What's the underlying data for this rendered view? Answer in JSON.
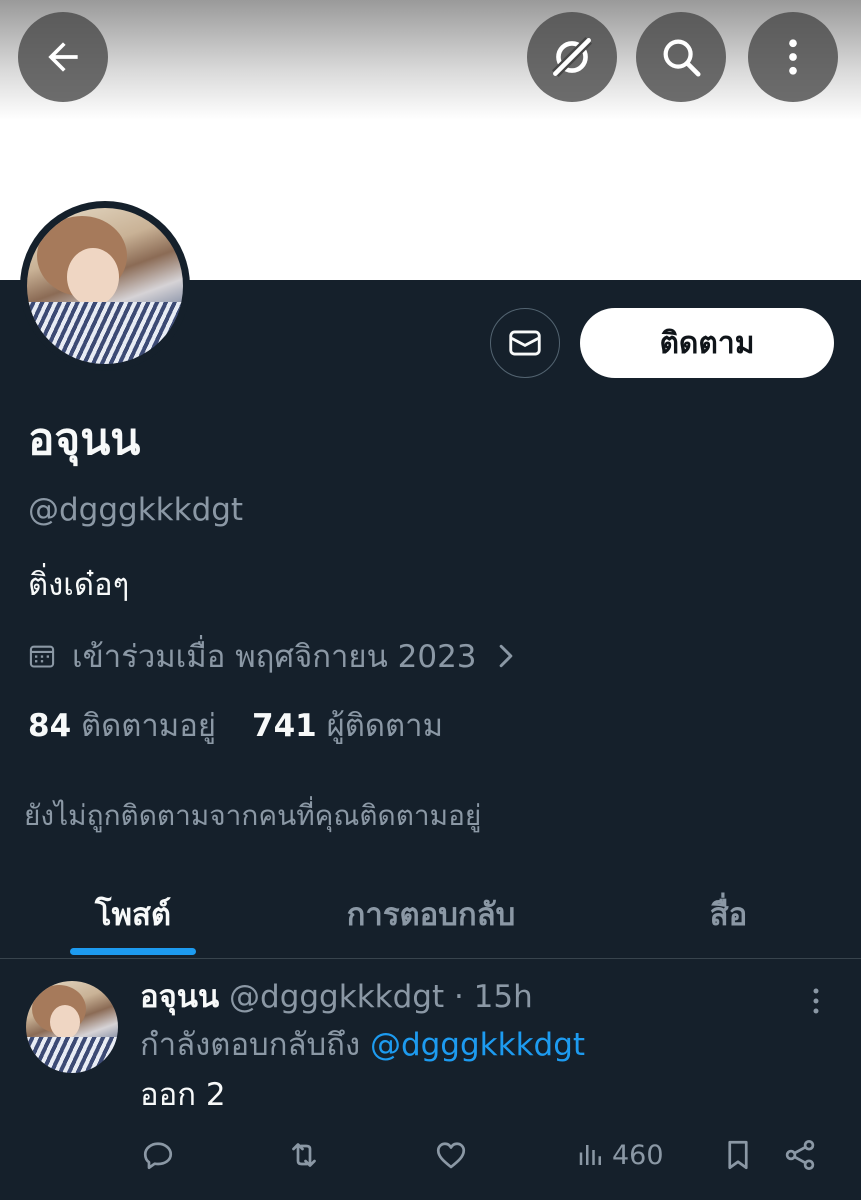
{
  "header": {
    "back_icon": "arrow-left-icon",
    "grok_icon": "grok-icon",
    "search_icon": "search-icon",
    "more_icon": "more-vertical-icon"
  },
  "profile": {
    "display_name": "อจุนน",
    "handle": "@dgggkkkdgt",
    "bio": "ติ่งเด๋อๆ",
    "joined": "เข้าร่วมเมื่อ พฤศจิกายน 2023",
    "following_count": "84",
    "following_label": "ติดตามอยู่",
    "followers_count": "741",
    "followers_label": "ผู้ติดตาม",
    "not_followed_text": "ยังไม่ถูกติดตามจากคนที่คุณติดตามอยู่",
    "follow_button": "ติดตาม",
    "message_icon": "mail-icon"
  },
  "tabs": [
    {
      "label": "โพสต์",
      "active": true
    },
    {
      "label": "การตอบกลับ",
      "active": false
    },
    {
      "label": "สื่อ",
      "active": false
    }
  ],
  "post": {
    "name": "อจุนน",
    "meta": " @dgggkkkdgt · 15h",
    "reply_prefix": "กำลังตอบกลับถึง ",
    "reply_handle": "@dgggkkkdgt",
    "text": "ออก 2",
    "views": "460"
  },
  "colors": {
    "background": "#15202b",
    "accent": "#1d9bf0",
    "muted_text": "#8b98a5"
  }
}
